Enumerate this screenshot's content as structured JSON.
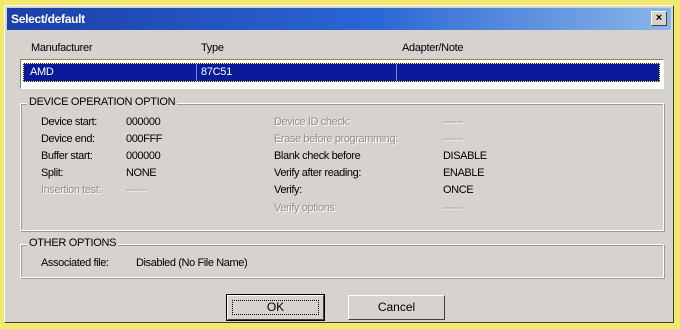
{
  "window": {
    "title": "Select/default",
    "close_glyph": "×"
  },
  "list": {
    "columns": [
      "Manufacturer",
      "Type",
      "Adapter/Note"
    ],
    "rows": [
      {
        "manufacturer": "AMD",
        "type": "87C51",
        "note": ""
      }
    ]
  },
  "device_options": {
    "legend": "DEVICE OPERATION OPTION",
    "left": [
      {
        "label": "Device start:",
        "value": "000000",
        "enabled": true
      },
      {
        "label": "Device end:",
        "value": "000FFF",
        "enabled": true
      },
      {
        "label": "Buffer start:",
        "value": "000000",
        "enabled": true
      },
      {
        "label": "Split:",
        "value": "NONE",
        "enabled": true
      },
      {
        "label": "Insertion test:",
        "value": "------",
        "enabled": false
      }
    ],
    "right": [
      {
        "label": "Device ID check:",
        "value": "------",
        "enabled": false
      },
      {
        "label": "Erase before programming:",
        "value": "------",
        "enabled": false
      },
      {
        "label": "Blank check before",
        "value": "DISABLE",
        "enabled": true
      },
      {
        "label": "Verify after reading:",
        "value": "ENABLE",
        "enabled": true
      },
      {
        "label": "Verify:",
        "value": "ONCE",
        "enabled": true
      },
      {
        "label": "Verify options:",
        "value": "------",
        "enabled": false
      }
    ]
  },
  "other_options": {
    "legend": "OTHER OPTIONS",
    "associated_label": "Associated file:",
    "associated_value": "Disabled (No File Name)"
  },
  "buttons": {
    "ok": "OK",
    "cancel": "Cancel"
  },
  "colors": {
    "title_start": "#1c3fa8",
    "title_end": "#8ab6e8",
    "selection": "#0a1a9a",
    "dialog_bg": "#d6d3ce",
    "backdrop": "#f2e96a"
  }
}
